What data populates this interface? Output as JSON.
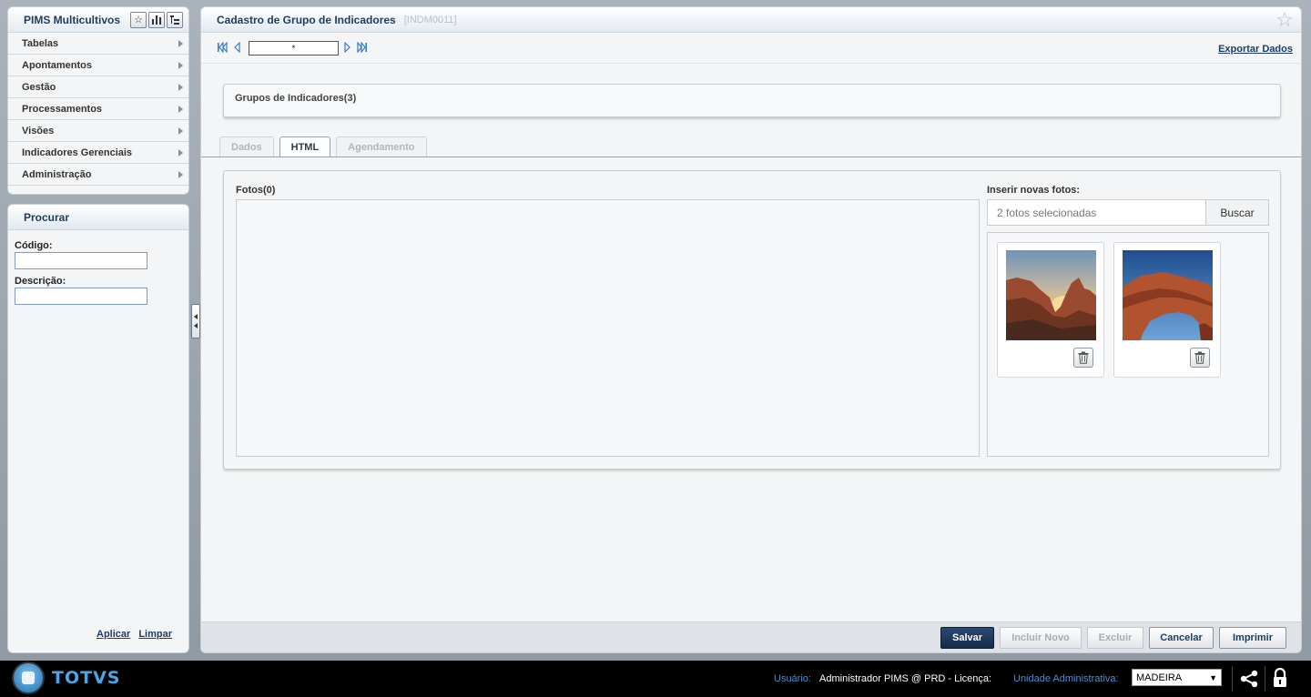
{
  "sidebar": {
    "title": "PIMS Multicultivos",
    "header_icons": [
      "star-icon",
      "bar-chart-icon",
      "tree-list-icon"
    ],
    "menu_items": [
      {
        "label": "Tabelas"
      },
      {
        "label": "Apontamentos"
      },
      {
        "label": "Gestão"
      },
      {
        "label": "Processamentos"
      },
      {
        "label": "Visões"
      },
      {
        "label": "Indicadores Gerenciais"
      },
      {
        "label": "Administração"
      }
    ]
  },
  "search": {
    "title": "Procurar",
    "code_label": "Código:",
    "code_value": "",
    "description_label": "Descrição:",
    "description_value": "",
    "apply_label": "Aplicar",
    "clear_label": "Limpar"
  },
  "main": {
    "title": "Cadastro de Grupo de Indicadores",
    "code": "[INDM0011]",
    "record_field_value": "*",
    "export_label": "Exportar Dados",
    "groups_label": "Grupos de Indicadores(3)",
    "tabs": [
      {
        "label": "Dados",
        "active": false
      },
      {
        "label": "HTML",
        "active": true
      },
      {
        "label": "Agendamento",
        "active": false
      }
    ],
    "photos_label": "Fotos(0)",
    "insert_label": "Inserir novas fotos:",
    "file_input_text": "2 fotos selecionadas",
    "browse_label": "Buscar"
  },
  "actions": {
    "save": "Salvar",
    "new": "Incluir Novo",
    "delete": "Excluir",
    "cancel": "Cancelar",
    "print": "Imprimir"
  },
  "footer": {
    "logo_text": "TOTVS",
    "user_label": "Usuário:",
    "user_value": "Administrador PIMS @ PRD - Licença:",
    "unit_label": "Unidade Administrativa:",
    "unit_value": "MADEIRA"
  },
  "colors": {
    "primary_button": "#1d3457",
    "link": "#1d3c6e",
    "footer_bg": "#000000",
    "footer_label": "#4f8ed0"
  }
}
